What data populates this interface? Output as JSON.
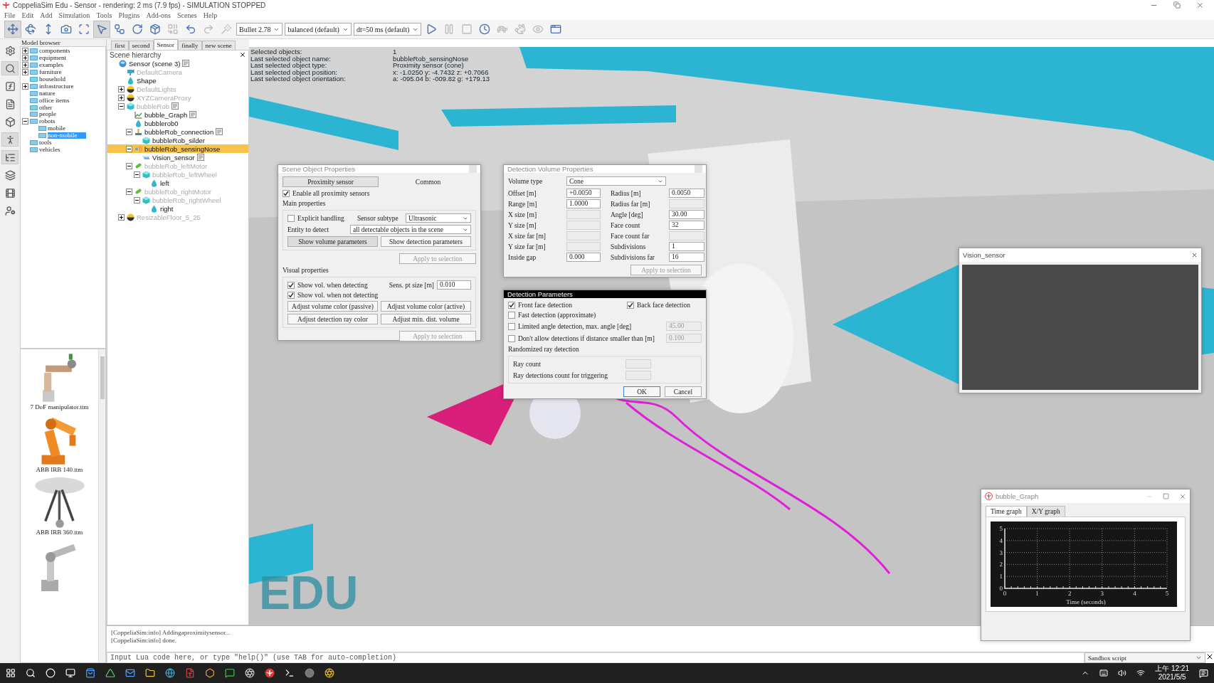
{
  "window": {
    "title": "CoppeliaSim Edu - Sensor - rendering: 2 ms (7.9 fps) - SIMULATION STOPPED"
  },
  "menu": [
    "File",
    "Edit",
    "Add",
    "Simulation",
    "Tools",
    "Plugins",
    "Add-ons",
    "Scenes",
    "Help"
  ],
  "toolbar": [
    {
      "kind": "move",
      "selected": true,
      "disabled": false
    },
    {
      "kind": "rotate",
      "selected": false,
      "disabled": false
    },
    {
      "kind": "vertical",
      "selected": false,
      "disabled": false
    },
    {
      "kind": "camera",
      "selected": false,
      "disabled": false
    },
    {
      "kind": "fit",
      "selected": false,
      "disabled": false
    },
    {
      "kind": "select",
      "selected": true,
      "disabled": false
    },
    {
      "kind": "nodes",
      "selected": false,
      "disabled": false
    },
    {
      "kind": "rotate_objects",
      "selected": false,
      "disabled": false
    },
    {
      "kind": "assembly",
      "selected": false,
      "disabled": false
    },
    {
      "kind": "transfer",
      "selected": false,
      "disabled": true
    },
    {
      "kind": "undo",
      "selected": false,
      "disabled": false
    },
    {
      "kind": "redo",
      "selected": false,
      "disabled": true
    },
    {
      "kind": "wand",
      "selected": false,
      "disabled": true
    },
    {
      "kind": "dropdown",
      "value": "Bullet 2.78"
    },
    {
      "kind": "dropdown",
      "value": "balanced (default)"
    },
    {
      "kind": "dropdown",
      "value": "dt=50 ms (default)"
    },
    {
      "kind": "play",
      "selected": false,
      "disabled": false
    },
    {
      "kind": "pause",
      "selected": false,
      "disabled": true
    },
    {
      "kind": "stop",
      "selected": false,
      "disabled": true
    },
    {
      "kind": "realtime",
      "selected": false,
      "disabled": false
    },
    {
      "kind": "slower",
      "selected": false,
      "disabled": true
    },
    {
      "kind": "faster",
      "selected": false,
      "disabled": true
    },
    {
      "kind": "visualization",
      "selected": false,
      "disabled": true
    },
    {
      "kind": "windows",
      "selected": false,
      "disabled": false
    }
  ],
  "side_toolbar": [
    {
      "kind": "simulation",
      "selected": false
    },
    {
      "kind": "search",
      "selected": true
    },
    {
      "kind": "function",
      "selected": false
    },
    {
      "kind": "document",
      "selected": false
    },
    {
      "kind": "object",
      "selected": false
    },
    {
      "kind": "figure",
      "selected": true
    },
    {
      "kind": "list",
      "selected": true
    },
    {
      "kind": "layers",
      "selected": false
    },
    {
      "kind": "film",
      "selected": false
    },
    {
      "kind": "user",
      "selected": false
    }
  ],
  "model_browser": {
    "title": "Model browser",
    "items": [
      {
        "label": "components",
        "expanded": false,
        "selected": false
      },
      {
        "label": "equipment",
        "expanded": false,
        "selected": false
      },
      {
        "label": "examples",
        "expanded": false,
        "selected": false
      },
      {
        "label": "furniture",
        "expanded": false,
        "selected": false
      },
      {
        "label": "household",
        "selected": false
      },
      {
        "label": "infrastructure",
        "expanded": false,
        "selected": false
      },
      {
        "label": "nature",
        "selected": false
      },
      {
        "label": "office items",
        "selected": false
      },
      {
        "label": "other",
        "selected": false
      },
      {
        "label": "people",
        "selected": false
      },
      {
        "label": "robots",
        "expanded": true,
        "selected": false,
        "children": [
          {
            "label": "mobile",
            "selected": false
          },
          {
            "label": "non-mobile",
            "selected": true
          }
        ]
      },
      {
        "label": "tools",
        "selected": false
      },
      {
        "label": "vehicles",
        "selected": false
      }
    ],
    "thumbnails": [
      {
        "kind": "picture",
        "label": "7 DoF manipulator.ttm"
      },
      {
        "kind": "picture",
        "label": "ABB IRB 140.ttm"
      },
      {
        "kind": "picture",
        "label": "ABB IRB 360.ttm"
      },
      {
        "kind": "picture"
      }
    ]
  },
  "scene_tabs": [
    {
      "label": "first",
      "selected": false
    },
    {
      "label": "second",
      "selected": false
    },
    {
      "label": "Sensor",
      "selected": true
    },
    {
      "label": "finally",
      "selected": false
    },
    {
      "label": "new scene",
      "selected": false
    }
  ],
  "scene_hierarchy": {
    "title": "Scene hierarchy",
    "items": [
      {
        "label": "Sensor (scene 3)",
        "kind": "scene",
        "dimmed": false,
        "selected": false,
        "script": true,
        "children": [
          {
            "label": "DefaultCamera",
            "kind": "camera",
            "dimmed": true,
            "selected": false,
            "script": false
          },
          {
            "label": "Shape",
            "kind": "shape",
            "dimmed": false,
            "selected": false,
            "script": false
          },
          {
            "label": "DefaultLights",
            "kind": "light",
            "dimmed": true,
            "selected": false,
            "script": false,
            "expanded": false
          },
          {
            "label": "XYZCameraProxy",
            "kind": "light",
            "dimmed": true,
            "selected": false,
            "script": false,
            "expanded": false
          },
          {
            "label": "bubbleRob",
            "kind": "cube",
            "dimmed": true,
            "selected": false,
            "script": true,
            "expanded": true,
            "children": [
              {
                "label": "bubble_Graph",
                "kind": "graph",
                "dimmed": false,
                "selected": false,
                "script": true
              },
              {
                "label": "bubblerob0",
                "kind": "shape",
                "dimmed": false,
                "selected": false,
                "script": false
              },
              {
                "label": "bubbleRob_connection",
                "kind": "joint",
                "dimmed": false,
                "selected": false,
                "script": true,
                "expanded": true,
                "children": [
                  {
                    "label": "bubbleRob_silder",
                    "kind": "cube",
                    "dimmed": false,
                    "selected": false,
                    "script": false
                  }
                ]
              },
              {
                "label": "bubbleRob_sensingNose",
                "kind": "proximity",
                "dimmed": false,
                "selected": true,
                "script": false,
                "expanded": true,
                "children": [
                  {
                    "label": "Vision_sensor",
                    "kind": "vision",
                    "dimmed": false,
                    "selected": false,
                    "script": true
                  }
                ]
              },
              {
                "label": "bubbleRob_leftMotor",
                "kind": "motor",
                "dimmed": true,
                "selected": false,
                "script": false,
                "expanded": true,
                "children": [
                  {
                    "label": "bubbleRob_leftWheel",
                    "kind": "cube",
                    "dimmed": true,
                    "selected": false,
                    "script": false,
                    "expanded": true,
                    "children": [
                      {
                        "label": "left",
                        "kind": "shape",
                        "dimmed": false,
                        "selected": false,
                        "script": false
                      }
                    ]
                  }
                ]
              },
              {
                "label": "bubbleRob_rightMotor",
                "kind": "motor",
                "dimmed": true,
                "selected": false,
                "script": false,
                "expanded": true,
                "children": [
                  {
                    "label": "bubbleRob_rightWheel",
                    "kind": "cube",
                    "dimmed": true,
                    "selected": false,
                    "script": false,
                    "expanded": true,
                    "children": [
                      {
                        "label": "right",
                        "kind": "shape",
                        "dimmed": false,
                        "selected": false,
                        "script": false
                      }
                    ]
                  }
                ]
              }
            ]
          },
          {
            "label": "ResizableFloor_5_25",
            "kind": "light",
            "dimmed": true,
            "selected": false,
            "script": false,
            "expanded": false
          }
        ]
      }
    ]
  },
  "selection_info": [
    {
      "label": "Selected objects:",
      "value": "1"
    },
    {
      "label": "Last selected object name:",
      "value": "bubbleRob_sensingNose"
    },
    {
      "label": "Last selected object type:",
      "value": "Proximity sensor (cone)"
    },
    {
      "label": "Last selected object position:",
      "value": "x: -1.0250   y: -4.7432   z: +0.7066"
    },
    {
      "label": "Last selected object orientation:",
      "value": "a: -095.04   b: -009.82   g: +179.13"
    }
  ],
  "viewport": {
    "watermark": "EDU"
  },
  "scene_object_properties": {
    "title": "Scene Object Properties",
    "tabs": [
      {
        "label": "Proximity sensor",
        "selected": true
      },
      {
        "label": "Common",
        "selected": false
      }
    ],
    "enable_all": {
      "label": "Enable all proximity sensors",
      "checked": true
    },
    "main_title": "Main properties",
    "explicit_handling": {
      "label": "Explicit handling",
      "checked": false
    },
    "sensor_subtype": {
      "label": "Sensor subtype",
      "value": "Ultrasonic"
    },
    "entity_to_detect": {
      "label": "Entity to detect",
      "value": "all detectable objects in the scene"
    },
    "main_buttons": [
      {
        "label": "Show volume parameters",
        "selected": true
      },
      {
        "label": "Show detection parameters",
        "selected": false
      }
    ],
    "main_apply": {
      "label": "Apply to selection",
      "disabled": true
    },
    "visual_title": "Visual properties",
    "visual_checks": [
      {
        "label": "Show vol. when detecting",
        "checked": true
      },
      {
        "label": "Show vol. when not detecting",
        "checked": true
      }
    ],
    "point_size": {
      "label": "Sens. pt size [m]",
      "value": "0.010"
    },
    "visual_buttons": [
      "Adjust volume color (passive)",
      "Adjust volume color (active)",
      "Adjust detection ray color",
      "Adjust min. dist. volume"
    ],
    "visual_apply": {
      "label": "Apply to selection",
      "disabled": true
    }
  },
  "detection_volume_properties": {
    "title": "Detection Volume Properties",
    "volume_type": {
      "label": "Volume type",
      "value": "Cone"
    },
    "left_fields": [
      {
        "label": "Offset [m]",
        "value": "+0.0050",
        "disabled": false
      },
      {
        "label": "Range [m]",
        "value": "1.0000",
        "disabled": false
      },
      {
        "label": "X size [m]",
        "disabled": true
      },
      {
        "label": "Y size [m]",
        "disabled": true
      },
      {
        "label": "X size far [m]",
        "disabled": true
      },
      {
        "label": "Y size far [m]",
        "disabled": true
      },
      {
        "label": "Inside gap",
        "value": "0.000",
        "disabled": false
      }
    ],
    "right_fields": [
      {
        "label": "Radius [m]",
        "value": "0.0050",
        "disabled": false
      },
      {
        "label": "Radius far [m]",
        "disabled": true
      },
      {
        "label": "Angle [deg]",
        "value": "30.00",
        "disabled": false
      },
      {
        "label": "Face count",
        "value": "32",
        "disabled": false
      },
      {
        "label": "Face count far",
        "disabled": true
      },
      {
        "label": "Subdivisions",
        "value": "1",
        "disabled": false
      },
      {
        "label": "Subdivisions far",
        "value": "16",
        "disabled": false
      }
    ],
    "apply": {
      "label": "Apply to selection",
      "disabled": true
    }
  },
  "detection_parameters": {
    "title": "Detection Parameters",
    "face_checks": [
      {
        "label": "Front face detection",
        "checked": true
      },
      {
        "label": "Back face detection",
        "checked": true
      }
    ],
    "options": [
      {
        "label": "Fast detection (approximate)",
        "checked": false
      },
      {
        "label": "Limited angle detection, max. angle [deg]",
        "checked": false,
        "value": "45.00"
      },
      {
        "label": "Don't allow detections if distance smaller than [m]",
        "checked": false,
        "value": "0.100"
      }
    ],
    "random_title": "Randomized ray detection",
    "random_fields": [
      {
        "label": "Ray count",
        "disabled": true
      },
      {
        "label": "Ray detections count for triggering",
        "disabled": true
      }
    ],
    "buttons": [
      {
        "label": "OK",
        "default": true
      },
      {
        "label": "Cancel",
        "default": false
      }
    ]
  },
  "vision_sensor_window": {
    "title": "Vision_sensor"
  },
  "graph_window": {
    "title": "bubble_Graph",
    "tabs": [
      {
        "label": "Time graph",
        "selected": true
      },
      {
        "label": "X/Y graph",
        "selected": false
      }
    ],
    "chart_data": {
      "type": "line",
      "grid": true,
      "xlabel": "Time (seconds)",
      "xlim": [
        0,
        5
      ],
      "ylim": [
        0,
        5
      ],
      "xticks": [
        0,
        1,
        2,
        3,
        4,
        5
      ],
      "yticks": [
        0,
        1,
        2,
        3,
        4,
        5
      ]
    }
  },
  "console": {
    "lines": [
      "[CoppeliaSim:info] Addingaproximitysensor...",
      "[CoppeliaSim:info] done."
    ],
    "input_placeholder": "Input Lua code here, or type \"help()\" (use TAB for auto-completion)",
    "script_select": "Sandbox script"
  },
  "taskbar": {
    "time": "上午 12:21",
    "date": "2021/5/5"
  }
}
